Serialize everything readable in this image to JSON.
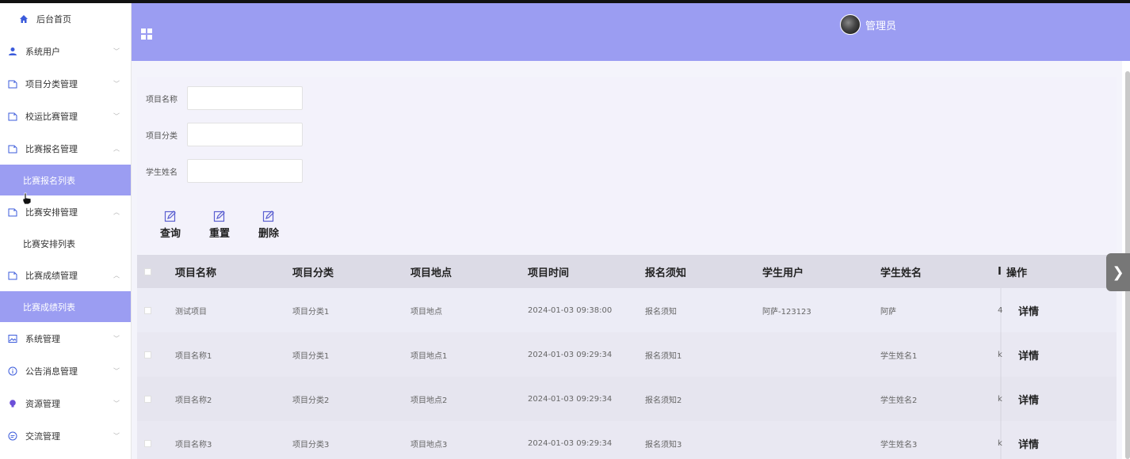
{
  "sidebar": {
    "home": "后台首页",
    "items": [
      {
        "label": "系统用户",
        "icon": "user-icon"
      },
      {
        "label": "项目分类管理",
        "icon": "tag-icon"
      },
      {
        "label": "校运比赛管理",
        "icon": "tag-icon"
      },
      {
        "label": "比赛报名管理",
        "icon": "tag-icon",
        "sub": "比赛报名列表"
      },
      {
        "label": "比赛安排管理",
        "icon": "tag-icon",
        "sub": "比赛安排列表"
      },
      {
        "label": "比赛成绩管理",
        "icon": "tag-icon",
        "sub": "比赛成绩列表"
      },
      {
        "label": "系统管理",
        "icon": "picture-icon"
      },
      {
        "label": "公告消息管理",
        "icon": "info-icon"
      },
      {
        "label": "资源管理",
        "icon": "bulb-icon"
      },
      {
        "label": "交流管理",
        "icon": "chat-icon"
      }
    ]
  },
  "header": {
    "username": "管理员"
  },
  "search": {
    "fields": [
      {
        "label": "项目名称",
        "value": ""
      },
      {
        "label": "项目分类",
        "value": ""
      },
      {
        "label": "学生姓名",
        "value": ""
      }
    ],
    "buttons": [
      "查询",
      "重置",
      "删除"
    ]
  },
  "table": {
    "headers": [
      "项目名称",
      "项目分类",
      "项目地点",
      "项目时间",
      "报名须知",
      "学生用户",
      "学生姓名",
      "I",
      "操作"
    ],
    "rows": [
      [
        "测试项目",
        "项目分类1",
        "项目地点",
        "2024-01-03 09:38:00",
        "报名须知",
        "阿萨-123123",
        "阿萨",
        "4",
        "详情"
      ],
      [
        "项目名称1",
        "项目分类1",
        "项目地点1",
        "2024-01-03 09:29:34",
        "报名须知1",
        "",
        "学生姓名1",
        "k",
        "详情"
      ],
      [
        "项目名称2",
        "项目分类2",
        "项目地点2",
        "2024-01-03 09:29:34",
        "报名须知2",
        "",
        "学生姓名2",
        "k",
        "详情"
      ],
      [
        "项目名称3",
        "项目分类3",
        "项目地点3",
        "2024-01-03 09:29:34",
        "报名须知3",
        "",
        "学生姓名3",
        "k",
        "详情"
      ]
    ]
  },
  "colors": {
    "accent": "#9b9df2",
    "home_icon": "#3b5bdb",
    "user_icon": "#3b5bdb",
    "bulb_icon": "#6b4fd8"
  }
}
